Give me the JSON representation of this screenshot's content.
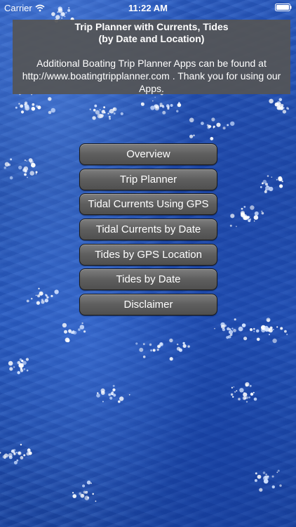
{
  "status_bar": {
    "carrier": "Carrier",
    "time": "11:22 AM",
    "wifi_icon": "wifi-icon",
    "battery_icon": "battery-icon",
    "battery_level": 1.0
  },
  "info_panel": {
    "title_line1": "Trip Planner with Currents, Tides",
    "title_line2": "(by Date and Location)",
    "body_line1": "Additional Boating Trip Planner Apps can be found at",
    "body_line2": "http://www.boatingtripplanner.com . Thank you for using our",
    "body_line3": "Apps."
  },
  "menu": {
    "buttons": [
      {
        "label": "Overview"
      },
      {
        "label": "Trip Planner"
      },
      {
        "label": "Tidal Currents Using GPS"
      },
      {
        "label": "Tidal Currents by Date"
      },
      {
        "label": "Tides by GPS Location"
      },
      {
        "label": "Tides by Date"
      },
      {
        "label": "Disclaimer"
      }
    ]
  },
  "colors": {
    "water": "#1f4fae",
    "panel": "#555555",
    "button": "#5e5e5e",
    "text": "#ffffff"
  }
}
